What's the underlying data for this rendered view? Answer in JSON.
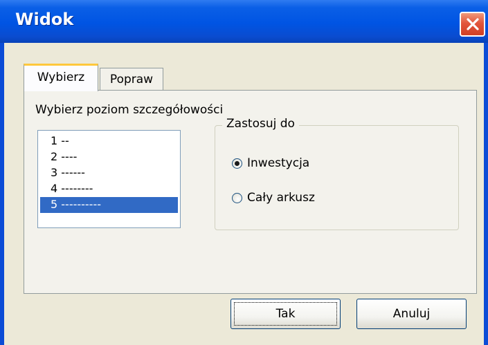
{
  "window": {
    "title": "Widok"
  },
  "tabs": [
    {
      "label": "Wybierz",
      "active": true
    },
    {
      "label": "Popraw",
      "active": false
    }
  ],
  "panel": {
    "detail_label": "Wybierz poziom szczegółowości",
    "levels": [
      {
        "text": "1 --",
        "selected": false
      },
      {
        "text": "2 ----",
        "selected": false
      },
      {
        "text": "3 ------",
        "selected": false
      },
      {
        "text": "4 --------",
        "selected": false
      },
      {
        "text": "5 ----------",
        "selected": true
      }
    ],
    "apply_group": {
      "title": "Zastosuj do",
      "options": [
        {
          "label": "Inwestycja",
          "checked": true
        },
        {
          "label": "Cały arkusz",
          "checked": false
        }
      ]
    }
  },
  "buttons": {
    "ok": "Tak",
    "cancel": "Anuluj"
  },
  "colors": {
    "titlebar": "#0054e3",
    "selection": "#316ac5",
    "close": "#e2563c",
    "dialog_bg": "#ece9d8"
  }
}
